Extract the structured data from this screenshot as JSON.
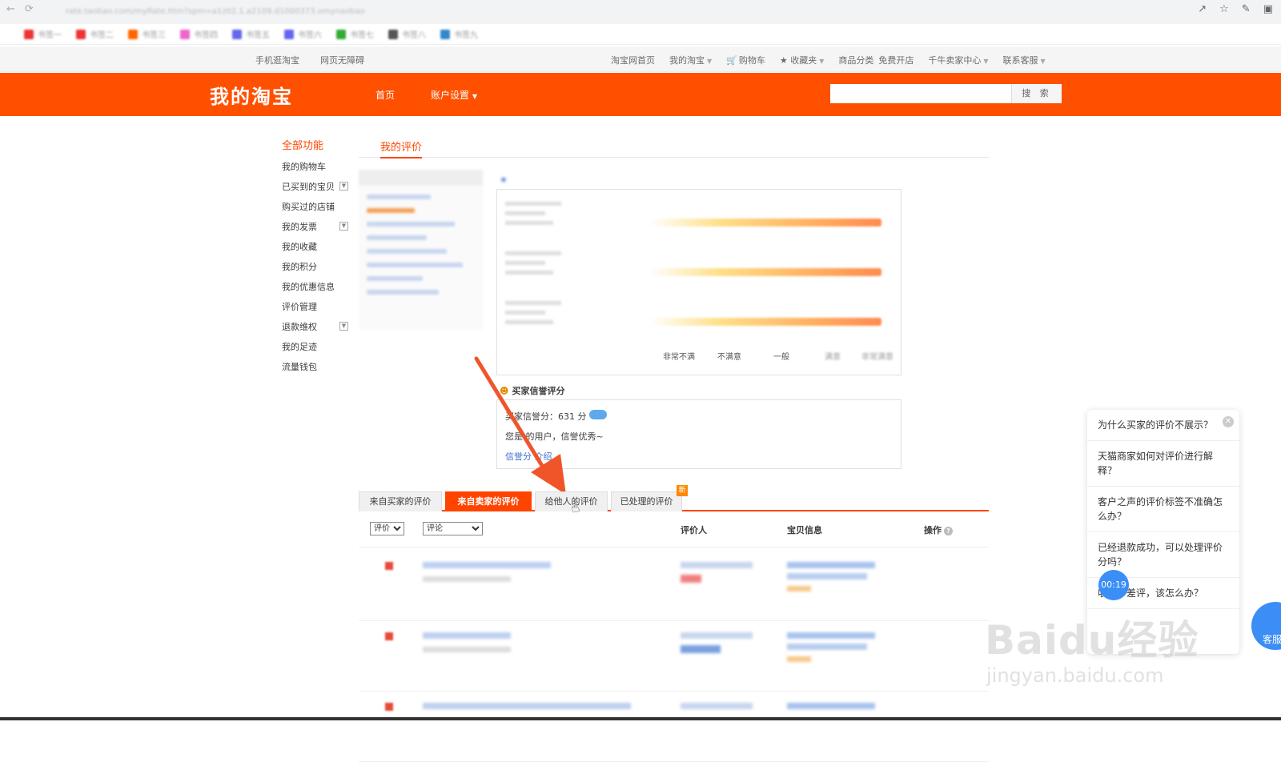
{
  "browser": {
    "url": "rate.taobao.com/myRate.htm?spm=a1z02.1.a2109.d1000373.omynaobao",
    "bookmarks": [
      "书签一",
      "书签二",
      "书签三",
      "书签四",
      "书签五",
      "书签六",
      "书签七",
      "书签八",
      "书签九"
    ]
  },
  "site_nav": {
    "left": [
      "手机逛淘宝",
      "网页无障碍"
    ],
    "right": [
      "淘宝网首页",
      "我的淘宝",
      "购物车",
      "收藏夹",
      "商品分类",
      "免费开店",
      "千牛卖家中心",
      "联系客服"
    ]
  },
  "header": {
    "logo": "我的淘宝",
    "nav_home": "首页",
    "nav_account": "账户设置",
    "search_button": "搜 索",
    "search_placeholder": ""
  },
  "sidebar": {
    "title": "全部功能",
    "items": [
      "我的购物车",
      "已买到的宝贝",
      "购买过的店铺",
      "我的发票",
      "我的收藏",
      "我的积分",
      "我的优惠信息",
      "评价管理",
      "退款维权",
      "我的足迹",
      "流量钱包"
    ]
  },
  "page_tab": "我的评价",
  "rating_scale": [
    "非常不满",
    "不满意",
    "一般",
    "满意",
    "非常满意"
  ],
  "credit": {
    "title": "买家信誉评分",
    "score_text": "买家信誉分：631 分",
    "message": "您是 的用户，信誉优秀~",
    "link": "信誉分 介绍"
  },
  "tabs": {
    "from_buyer": "来自买家的评价",
    "from_seller": "来自卖家的评价",
    "to_others": "给他人的评价",
    "handled": "已处理的评价",
    "new_badge": "新"
  },
  "filters": {
    "rating": "评价",
    "content": "评论"
  },
  "columns": {
    "reviewer": "评价人",
    "item_info": "宝贝信息",
    "action": "操作"
  },
  "help": {
    "questions": [
      "为什么买家的评价不展示？",
      "天猫商家如何对评价进行解释？",
      "客户之声的评价标签不准确怎么办？",
      "已经退款成功，可以处理评价 分吗？",
      "收到中差评，该怎么办？"
    ],
    "timer": "00:19",
    "service": "客服"
  },
  "watermark": {
    "brand": "Baidu经验",
    "url": "jingyan.baidu.com"
  }
}
